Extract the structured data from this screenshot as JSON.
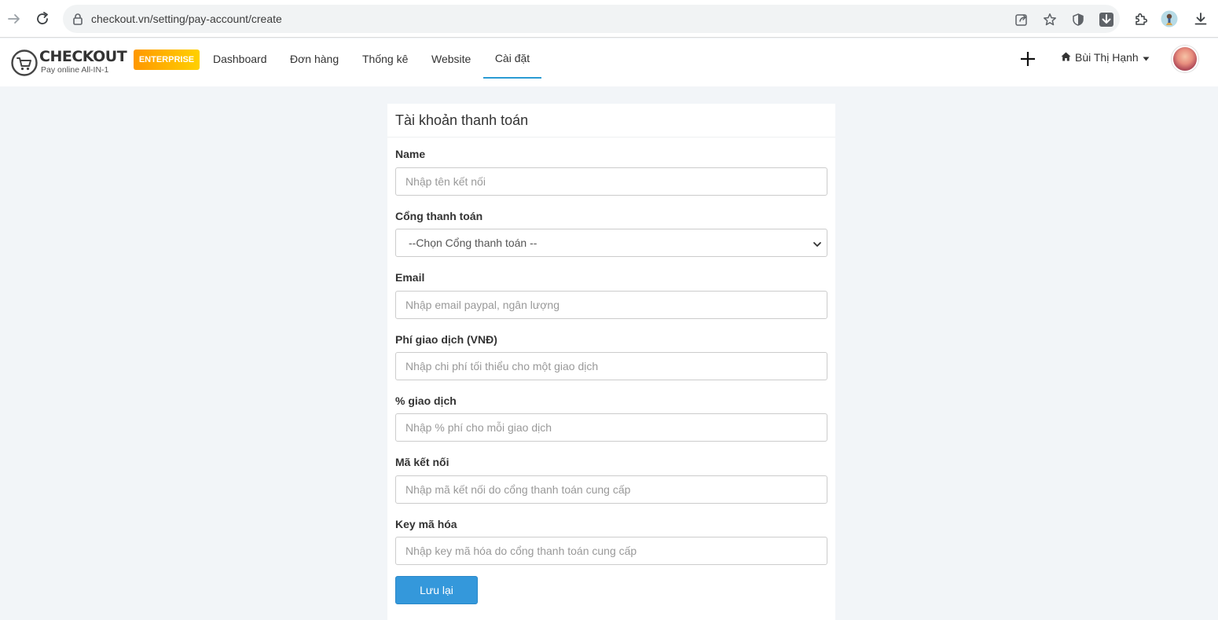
{
  "browser": {
    "url": "checkout.vn/setting/pay-account/create",
    "icons": [
      "forward-icon",
      "reload-icon",
      "lock-icon",
      "share-icon",
      "star-icon",
      "shield-icon",
      "download-ext-icon",
      "puzzle-icon",
      "profile-icon",
      "download-icon"
    ]
  },
  "header": {
    "logo_brand": "CHECKOUT",
    "logo_tagline": "Pay online All-IN-1",
    "badge": "ENTERPRISE",
    "nav": [
      {
        "label": "Dashboard"
      },
      {
        "label": "Đơn hàng"
      },
      {
        "label": "Thống kê"
      },
      {
        "label": "Website"
      },
      {
        "label": "Cài đặt"
      }
    ],
    "active_nav": "Cài đặt",
    "user_name": "Bùi Thị Hạnh",
    "accent_color": "#2b9bd3"
  },
  "form": {
    "title": "Tài khoản thanh toán",
    "name_label": "Name",
    "name_placeholder": "Nhập tên kết nối",
    "gateway_label": "Cổng thanh toán",
    "gateway_selected": "--Chọn Cổng thanh toán --",
    "email_label": "Email",
    "email_placeholder": "Nhập email paypal, ngân lượng",
    "fee_label": "Phí giao dịch (VNĐ)",
    "fee_placeholder": "Nhập chi phí tối thiểu cho một giao dịch",
    "percent_label": "% giao dịch",
    "percent_placeholder": "Nhập % phí cho mỗi giao dịch",
    "code_label": "Mã kết nối",
    "code_placeholder": "Nhập mã kết nối do cổng thanh toán cung cấp",
    "key_label": "Key mã hóa",
    "key_placeholder": "Nhập key mã hóa do cổng thanh toán cung cấp",
    "save_label": "Lưu lại",
    "button_color": "#3498db"
  }
}
